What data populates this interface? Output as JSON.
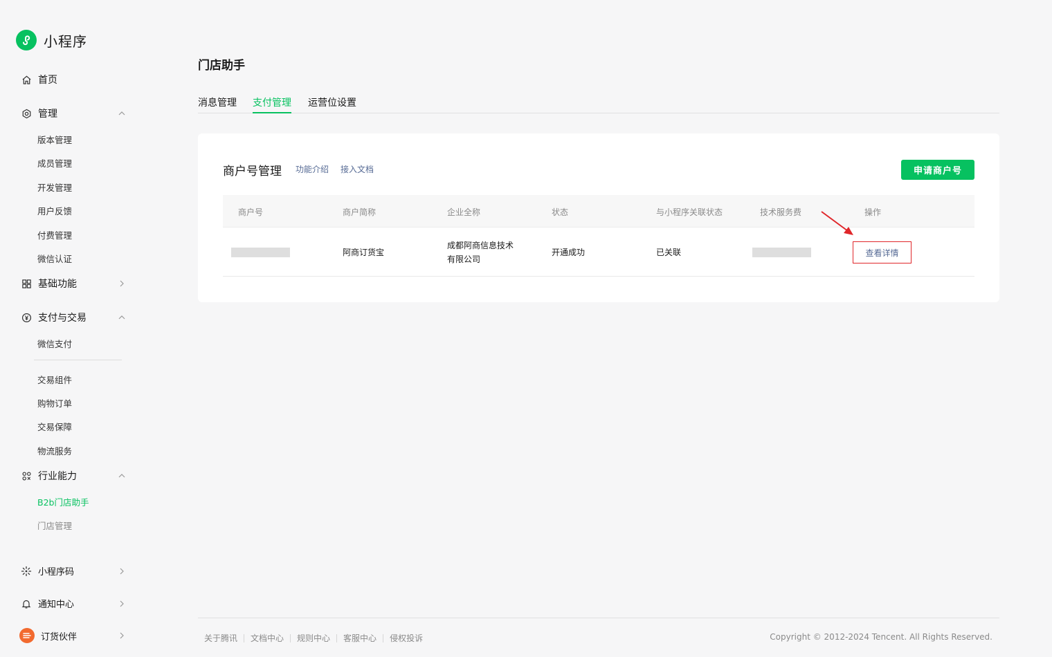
{
  "app": {
    "name": "小程序"
  },
  "sidebar": {
    "home": "首页",
    "manage": {
      "label": "管理",
      "items": [
        "版本管理",
        "成员管理",
        "开发管理",
        "用户反馈",
        "付费管理",
        "微信认证"
      ]
    },
    "basic": "基础功能",
    "payment": {
      "label": "支付与交易",
      "items": [
        "微信支付",
        "交易组件",
        "购物订单",
        "交易保障",
        "物流服务"
      ]
    },
    "industry": {
      "label": "行业能力",
      "items": [
        "B2b门店助手",
        "门店管理"
      ]
    },
    "qrcode": "小程序码",
    "notify": "通知中心",
    "partner": "订货伙伴"
  },
  "page": {
    "title": "门店助手",
    "tabs": [
      "消息管理",
      "支付管理",
      "运营位设置"
    ],
    "active_tab": "支付管理"
  },
  "merchant": {
    "title": "商户号管理",
    "links": [
      "功能介绍",
      "接入文档"
    ],
    "apply_button": "申请商户号",
    "columns": [
      "商户号",
      "商户简称",
      "企业全称",
      "状态",
      "与小程序关联状态",
      "技术服务费",
      "操作"
    ],
    "rows": [
      {
        "merchant_id": "",
        "short_name": "阿商订货宝",
        "full_name_line1": "成都阿商信息技术",
        "full_name_line2": "有限公司",
        "status": "开通成功",
        "link_status": "已关联",
        "service_fee": "",
        "action": "查看详情"
      }
    ]
  },
  "footer": {
    "links": [
      "关于腾讯",
      "文档中心",
      "规则中心",
      "客服中心",
      "侵权投诉"
    ],
    "copyright": "Copyright © 2012-2024 Tencent. All Rights Reserved."
  },
  "colors": {
    "accent": "#07c160",
    "link": "#576b95",
    "highlight": "#e0262a",
    "partner": "#f26a2f"
  }
}
